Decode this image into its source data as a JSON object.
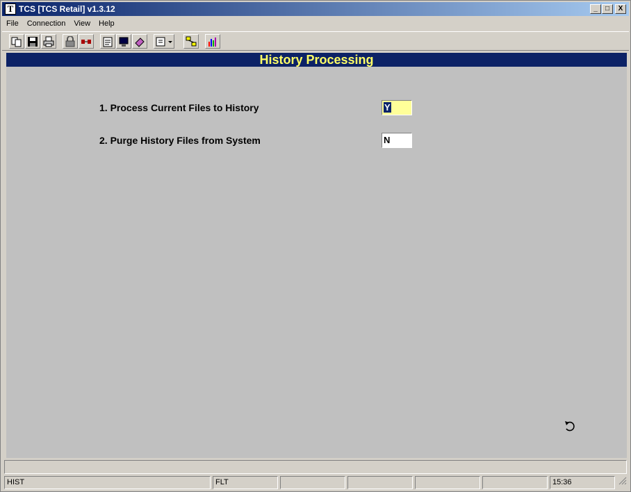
{
  "window": {
    "title": "TCS [TCS Retail]  v1.3.12",
    "app_icon_letter": "T"
  },
  "title_buttons": {
    "minimize": "_",
    "maximize": "□",
    "close": "X"
  },
  "menu": [
    "File",
    "Connection",
    "View",
    "Help"
  ],
  "toolbar_icons": [
    "copy-icon",
    "save-icon",
    "print-icon",
    "lock-icon",
    "connect-icon",
    "properties-icon",
    "monitor-icon",
    "eraser-icon",
    "document-dropdown-icon",
    "network-icon",
    "chart-icon"
  ],
  "screen": {
    "heading": "History Processing",
    "options": [
      {
        "label": "1.  Process Current Files to History",
        "value": "Y"
      },
      {
        "label": "2.  Purge History Files from System",
        "value": "N"
      }
    ]
  },
  "status": {
    "cells": [
      "HIST",
      "FLT",
      "",
      "",
      "",
      "",
      "",
      "15:36"
    ]
  },
  "colors": {
    "heading_bg": "#0c2266",
    "heading_fg": "#ffff66",
    "active_field": "#ffff99",
    "panel_bg": "#c0c0c0"
  }
}
